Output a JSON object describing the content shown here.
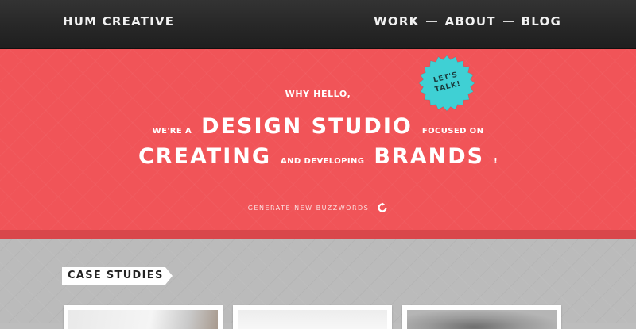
{
  "header": {
    "logo": "HUM CREATIVE",
    "nav": [
      {
        "label": "WORK"
      },
      {
        "label": "ABOUT"
      },
      {
        "label": "BLOG"
      }
    ]
  },
  "hero": {
    "greeting": "WHY HELLO,",
    "line2_prefix": "WE'RE A",
    "line2_highlight": "DESIGN STUDIO",
    "line2_suffix": "FOCUSED ON",
    "line3_highlight1": "CREATING",
    "line3_middle": "AND DEVELOPING",
    "line3_highlight2": "BRANDS",
    "line3_end": "!",
    "buzzwords_link": "GENERATE NEW BUZZWORDS",
    "buzzwords_icon": "refresh-icon"
  },
  "badge": {
    "line1": "LET'S",
    "line2": "TALK!",
    "color": "#3fd0d4"
  },
  "case_studies": {
    "heading": "CASE STUDIES"
  },
  "colors": {
    "header": "#262626",
    "hero": "#f15458",
    "badge": "#3fd0d4",
    "section": "#bbbbbb"
  }
}
